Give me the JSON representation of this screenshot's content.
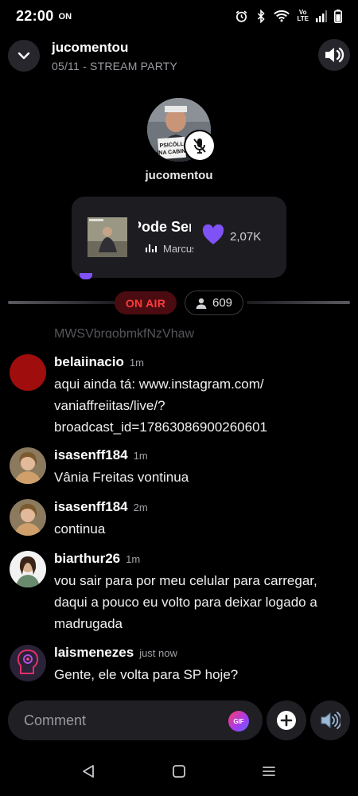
{
  "status_bar": {
    "time": "22:00",
    "on_indicator": "ON",
    "network_label_top": "Vo",
    "network_label_bottom": "LTE",
    "icons": [
      "alarm-icon",
      "bluetooth-icon",
      "wifi-icon",
      "signal-icon",
      "battery-icon"
    ]
  },
  "header": {
    "title": "jucomentou",
    "subtitle": "05/11 - STREAM PARTY",
    "collapse_icon": "chevron-down-icon",
    "sound_icon": "speaker-icon"
  },
  "host": {
    "name": "jucomentou",
    "sign_line1": "PSICÓLL",
    "sign_line2": "NA CABIN",
    "mic_icon": "mic-off-icon"
  },
  "now_playing": {
    "title": "Pode Ser",
    "artist": "Marcus Moretti",
    "likes": "2,07K",
    "heart_color": "#7f52f5"
  },
  "live": {
    "on_air_label": "ON AIR",
    "viewers": "609"
  },
  "chat": {
    "cut_text": "MWSVbrgobmkfNzVhaw",
    "messages": [
      {
        "user": "belaiinacio",
        "time": "1m",
        "text": "aqui ainda tá: www.instagram.com/ vaniaffreiitas/live/? broadcast_id=17863086900260601"
      },
      {
        "user": "isasenff184",
        "time": "1m",
        "text": "Vânia Freitas vontinua"
      },
      {
        "user": "isasenff184",
        "time": "2m",
        "text": "continua"
      },
      {
        "user": "biarthur26",
        "time": "1m",
        "text": "vou sair para por meu celular para carregar, daqui a pouco eu volto para deixar logado a madrugada"
      },
      {
        "user": "laismenezes",
        "time": "just now",
        "text": "Gente, ele volta para SP hoje?"
      }
    ]
  },
  "composer": {
    "placeholder": "Comment",
    "gif_label": "GIF"
  },
  "colors": {
    "background": "#000000",
    "on_air_text": "#ff3b3b",
    "on_air_bg": "#4a0c10",
    "accent_purple": "#7f52f5"
  }
}
